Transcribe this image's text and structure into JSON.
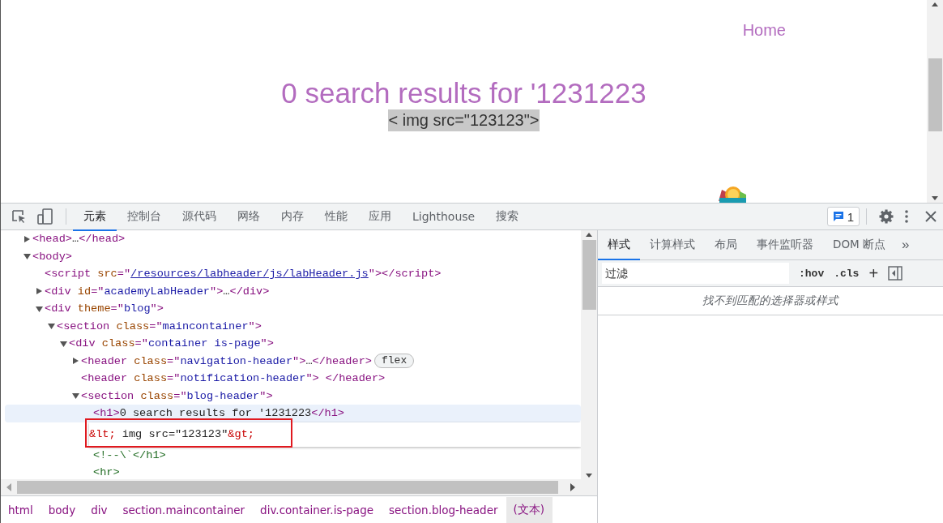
{
  "page": {
    "nav_link": "Home",
    "heading": "0 search results for '1231223",
    "subtext": "< img src=\"123123\">",
    "subtext_selected": true
  },
  "devtools": {
    "tabs": [
      {
        "label": "元素",
        "selected": true
      },
      {
        "label": "控制台",
        "selected": false
      },
      {
        "label": "源代码",
        "selected": false
      },
      {
        "label": "网络",
        "selected": false
      },
      {
        "label": "内存",
        "selected": false
      },
      {
        "label": "性能",
        "selected": false
      },
      {
        "label": "应用",
        "selected": false
      },
      {
        "label": "Lighthouse",
        "selected": false
      },
      {
        "label": "搜索",
        "selected": false
      }
    ],
    "issues_count": "1",
    "dom_tree": [
      {
        "expanded": false,
        "tokens": [
          {
            "kind": "tag",
            "t": "<head>"
          },
          {
            "kind": "text",
            "t": "…"
          },
          {
            "kind": "tag",
            "t": "</head>"
          }
        ]
      },
      {
        "expanded": true,
        "tokens": [
          {
            "kind": "tag",
            "t": "<body>"
          }
        ],
        "children": [
          {
            "tokens": [
              {
                "kind": "tag",
                "t": "<script"
              },
              {
                "kind": "attr",
                "t": " src"
              },
              {
                "kind": "tag",
                "t": "=\""
              },
              {
                "kind": "link",
                "t": "/resources/labheader/js/labHeader.js"
              },
              {
                "kind": "tag",
                "t": "\"></script>"
              }
            ]
          },
          {
            "expanded": false,
            "tokens": [
              {
                "kind": "tag",
                "t": "<div"
              },
              {
                "kind": "attr",
                "t": " id"
              },
              {
                "kind": "tag",
                "t": "=\""
              },
              {
                "kind": "value",
                "t": "academyLabHeader"
              },
              {
                "kind": "tag",
                "t": "\">"
              },
              {
                "kind": "text",
                "t": "…"
              },
              {
                "kind": "tag",
                "t": "</div>"
              }
            ]
          },
          {
            "expanded": true,
            "tokens": [
              {
                "kind": "tag",
                "t": "<div"
              },
              {
                "kind": "attr",
                "t": " theme"
              },
              {
                "kind": "tag",
                "t": "=\""
              },
              {
                "kind": "value",
                "t": "blog"
              },
              {
                "kind": "tag",
                "t": "\">"
              }
            ],
            "children": [
              {
                "expanded": true,
                "tokens": [
                  {
                    "kind": "tag",
                    "t": "<section"
                  },
                  {
                    "kind": "attr",
                    "t": " class"
                  },
                  {
                    "kind": "tag",
                    "t": "=\""
                  },
                  {
                    "kind": "value",
                    "t": "maincontainer"
                  },
                  {
                    "kind": "tag",
                    "t": "\">"
                  }
                ],
                "children": [
                  {
                    "expanded": true,
                    "tokens": [
                      {
                        "kind": "tag",
                        "t": "<div"
                      },
                      {
                        "kind": "attr",
                        "t": " class"
                      },
                      {
                        "kind": "tag",
                        "t": "=\""
                      },
                      {
                        "kind": "value",
                        "t": "container is-page"
                      },
                      {
                        "kind": "tag",
                        "t": "\">"
                      }
                    ],
                    "children": [
                      {
                        "expanded": false,
                        "tokens": [
                          {
                            "kind": "tag",
                            "t": "<header"
                          },
                          {
                            "kind": "attr",
                            "t": " class"
                          },
                          {
                            "kind": "tag",
                            "t": "=\""
                          },
                          {
                            "kind": "value",
                            "t": "navigation-header"
                          },
                          {
                            "kind": "tag",
                            "t": "\">"
                          },
                          {
                            "kind": "text",
                            "t": "…"
                          },
                          {
                            "kind": "tag",
                            "t": "</header>"
                          },
                          {
                            "kind": "badge",
                            "t": "flex"
                          }
                        ]
                      },
                      {
                        "tokens": [
                          {
                            "kind": "tag",
                            "t": "<header"
                          },
                          {
                            "kind": "attr",
                            "t": " class"
                          },
                          {
                            "kind": "tag",
                            "t": "=\""
                          },
                          {
                            "kind": "value",
                            "t": "notification-header"
                          },
                          {
                            "kind": "tag",
                            "t": "\"> </header>"
                          }
                        ]
                      },
                      {
                        "expanded": true,
                        "tokens": [
                          {
                            "kind": "tag",
                            "t": "<section"
                          },
                          {
                            "kind": "attr",
                            "t": " class"
                          },
                          {
                            "kind": "tag",
                            "t": "=\""
                          },
                          {
                            "kind": "value",
                            "t": "blog-header"
                          },
                          {
                            "kind": "tag",
                            "t": "\">"
                          }
                        ],
                        "children": [
                          {
                            "selected": true,
                            "tokens": [
                              {
                                "kind": "tag",
                                "t": "<h1>"
                              },
                              {
                                "kind": "text",
                                "t": "0 search results for '1231223"
                              },
                              {
                                "kind": "tag",
                                "t": "</h1>"
                              }
                            ]
                          },
                          {
                            "editing": true,
                            "highlighted": true,
                            "tokens": [
                              {
                                "kind": "entity",
                                "t": "&lt;"
                              },
                              {
                                "kind": "text",
                                "t": " img src=\"123123\""
                              },
                              {
                                "kind": "entity",
                                "t": "&gt;"
                              }
                            ]
                          },
                          {
                            "tokens": [
                              {
                                "kind": "comment",
                                "t": "<!--\\`</h1>"
                              }
                            ]
                          },
                          {
                            "tokens": [
                              {
                                "kind": "comment",
                                "t": "<hr>"
                              }
                            ]
                          }
                        ]
                      }
                    ]
                  }
                ]
              }
            ]
          }
        ]
      }
    ],
    "breadcrumbs": [
      {
        "label": "html",
        "selected": false
      },
      {
        "label": "body",
        "selected": false
      },
      {
        "label": "div",
        "selected": false
      },
      {
        "label": "section.maincontainer",
        "selected": false
      },
      {
        "label": "div.container.is-page",
        "selected": false
      },
      {
        "label": "section.blog-header",
        "selected": false
      },
      {
        "label": "(文本)",
        "selected": true
      }
    ],
    "side_tabs": [
      {
        "label": "样式",
        "selected": true
      },
      {
        "label": "计算样式",
        "selected": false
      },
      {
        "label": "布局",
        "selected": false
      },
      {
        "label": "事件监听器",
        "selected": false
      },
      {
        "label": "DOM 断点",
        "selected": false
      }
    ],
    "more_tabs": "»",
    "filter": {
      "placeholder": "过滤"
    },
    "hov": ":hov",
    "cls": ".cls",
    "add": "+",
    "empty_message": "找不到匹配的选择器或样式"
  }
}
